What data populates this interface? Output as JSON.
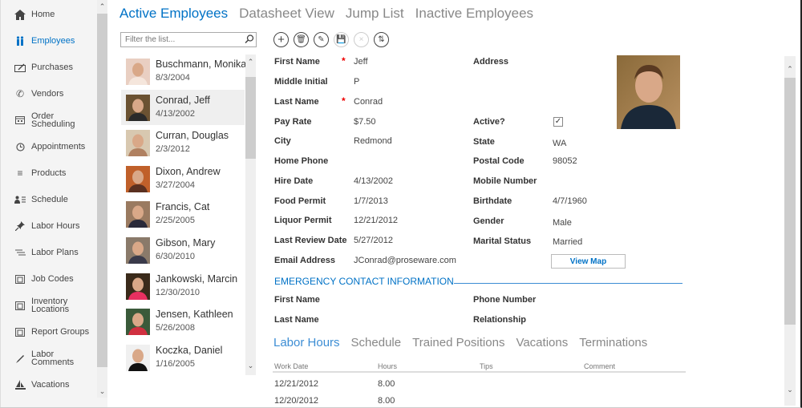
{
  "sidebar": {
    "items": [
      {
        "label": "Home",
        "icon": "home-icon"
      },
      {
        "label": "Employees",
        "icon": "employees-icon",
        "active": true
      },
      {
        "label": "Purchases",
        "icon": "purchases-icon"
      },
      {
        "label": "Vendors",
        "icon": "phone-icon"
      },
      {
        "label": "Order Scheduling",
        "icon": "calendar-icon"
      },
      {
        "label": "Appointments",
        "icon": "clock-icon"
      },
      {
        "label": "Products",
        "icon": "list-icon"
      },
      {
        "label": "Schedule",
        "icon": "person-list-icon"
      },
      {
        "label": "Labor Hours",
        "icon": "pin-icon"
      },
      {
        "label": "Labor Plans",
        "icon": "plans-icon"
      },
      {
        "label": "Job Codes",
        "icon": "document-icon"
      },
      {
        "label": "Inventory Locations",
        "icon": "document-icon"
      },
      {
        "label": "Report Groups",
        "icon": "document-icon"
      },
      {
        "label": "Labor Comments",
        "icon": "pencil-icon"
      },
      {
        "label": "Vacations",
        "icon": "sailboat-icon"
      }
    ]
  },
  "pivot": {
    "tabs": [
      "Active Employees",
      "Datasheet View",
      "Jump List",
      "Inactive Employees"
    ],
    "active": "Active Employees"
  },
  "filter": {
    "placeholder": "Filter the list..."
  },
  "toolbar": {
    "buttons": [
      {
        "name": "add",
        "glyph": "+",
        "enabled": true
      },
      {
        "name": "delete",
        "glyph": "🗑",
        "enabled": true
      },
      {
        "name": "edit",
        "glyph": "✎",
        "enabled": true
      },
      {
        "name": "save",
        "glyph": "💾",
        "enabled": false
      },
      {
        "name": "cancel",
        "glyph": "×",
        "enabled": false
      },
      {
        "name": "sort",
        "glyph": "⇅",
        "enabled": true
      }
    ]
  },
  "employees": [
    {
      "name": "Buschmann, Monika",
      "date": "8/3/2004",
      "colors": [
        "#e9cfc2",
        "#f5e6dc"
      ]
    },
    {
      "name": "Conrad, Jeff",
      "date": "4/13/2002",
      "selected": true,
      "colors": [
        "#6b5232",
        "#2a2a2a"
      ]
    },
    {
      "name": "Curran, Douglas",
      "date": "2/3/2012",
      "colors": [
        "#d8c8b0",
        "#b08060"
      ]
    },
    {
      "name": "Dixon, Andrew",
      "date": "3/27/2004",
      "colors": [
        "#c0602a",
        "#5a3020"
      ]
    },
    {
      "name": "Francis, Cat",
      "date": "2/25/2005",
      "colors": [
        "#9a7a60",
        "#2a2a3a"
      ]
    },
    {
      "name": "Gibson, Mary",
      "date": "6/30/2010",
      "colors": [
        "#8a7a6a",
        "#3a3a4a"
      ]
    },
    {
      "name": "Jankowski, Marcin",
      "date": "12/30/2010",
      "colors": [
        "#3a2a1a",
        "#e83060"
      ]
    },
    {
      "name": "Jensen, Kathleen",
      "date": "5/26/2008",
      "colors": [
        "#3a5a3a",
        "#d03040"
      ]
    },
    {
      "name": "Koczka, Daniel",
      "date": "1/16/2005",
      "colors": [
        "#f0f0f0",
        "#111111"
      ]
    }
  ],
  "form": {
    "left": [
      {
        "label": "First Name",
        "value": "Jeff",
        "required": true
      },
      {
        "label": "Middle Initial",
        "value": "P"
      },
      {
        "label": "Last Name",
        "value": "Conrad",
        "required": true
      },
      {
        "label": "Pay Rate",
        "value": "$7.50"
      },
      {
        "label": "City",
        "value": "Redmond"
      },
      {
        "label": "Home Phone",
        "value": ""
      },
      {
        "label": "Hire Date",
        "value": "4/13/2002"
      },
      {
        "label": "Food Permit",
        "value": "1/7/2013"
      },
      {
        "label": "Liquor Permit",
        "value": "12/21/2012"
      },
      {
        "label": "Last Review Date",
        "value": "5/27/2012"
      },
      {
        "label": "Email Address",
        "value": "JConrad@proseware.com"
      }
    ],
    "right": [
      {
        "label": "Address",
        "value": ""
      },
      {
        "label": "Active?",
        "value": "checked"
      },
      {
        "label": "State",
        "value": "WA"
      },
      {
        "label": "Postal Code",
        "value": "98052"
      },
      {
        "label": "Mobile Number",
        "value": ""
      },
      {
        "label": "Birthdate",
        "value": "4/7/1960"
      },
      {
        "label": "Gender",
        "value": "Male"
      },
      {
        "label": "Marital Status",
        "value": "Married"
      }
    ],
    "active_checked": true,
    "view_map_label": "View Map",
    "emergency": {
      "title": "EMERGENCY CONTACT INFORMATION",
      "left": [
        "First Name",
        "Last Name"
      ],
      "right": [
        "Phone Number",
        "Relationship"
      ]
    }
  },
  "subtabs": {
    "tabs": [
      "Labor Hours",
      "Schedule",
      "Trained Positions",
      "Vacations",
      "Terminations"
    ],
    "active": "Labor Hours"
  },
  "grid": {
    "columns": [
      "Work Date",
      "Hours",
      "Tips",
      "Comment"
    ],
    "rows": [
      [
        "12/21/2012",
        "8.00",
        "",
        ""
      ],
      [
        "12/20/2012",
        "8.00",
        "",
        ""
      ]
    ]
  },
  "colors": {
    "accent": "#0072c6",
    "required": "#ee0000"
  }
}
